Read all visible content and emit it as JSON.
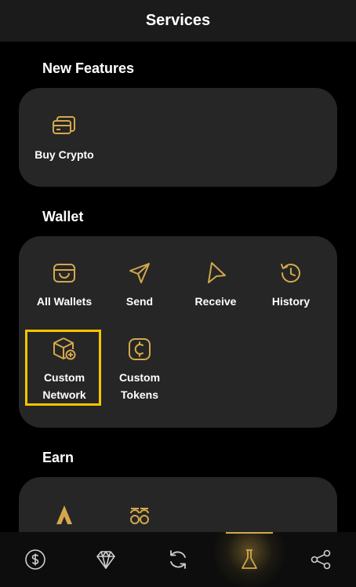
{
  "header": {
    "title": "Services"
  },
  "sections": {
    "new_features": {
      "title": "New Features",
      "items": [
        {
          "label": "Buy Crypto",
          "icon": "cards-icon"
        }
      ]
    },
    "wallet": {
      "title": "Wallet",
      "items": [
        {
          "label": "All Wallets",
          "icon": "wallet-icon"
        },
        {
          "label": "Send",
          "icon": "send-icon"
        },
        {
          "label": "Receive",
          "icon": "receive-icon"
        },
        {
          "label": "History",
          "icon": "history-icon"
        },
        {
          "label": "Custom\nNetwork",
          "icon": "cube-plus-icon",
          "highlighted": true
        },
        {
          "label": "Custom\nTokens",
          "icon": "coin-icon"
        }
      ]
    },
    "earn": {
      "title": "Earn",
      "items": [
        {
          "icon": "flame-logo-icon"
        },
        {
          "icon": "coins-stack-icon"
        }
      ]
    }
  },
  "tabbar": {
    "tabs": [
      {
        "icon": "dollar-icon"
      },
      {
        "icon": "diamond-icon"
      },
      {
        "icon": "refresh-icon"
      },
      {
        "icon": "flask-icon",
        "active": true
      },
      {
        "icon": "share-icon"
      }
    ]
  },
  "colors": {
    "accent": "#d3a84c",
    "card": "#262626",
    "highlight": "#f4c400",
    "header": "#1b1b1b"
  }
}
